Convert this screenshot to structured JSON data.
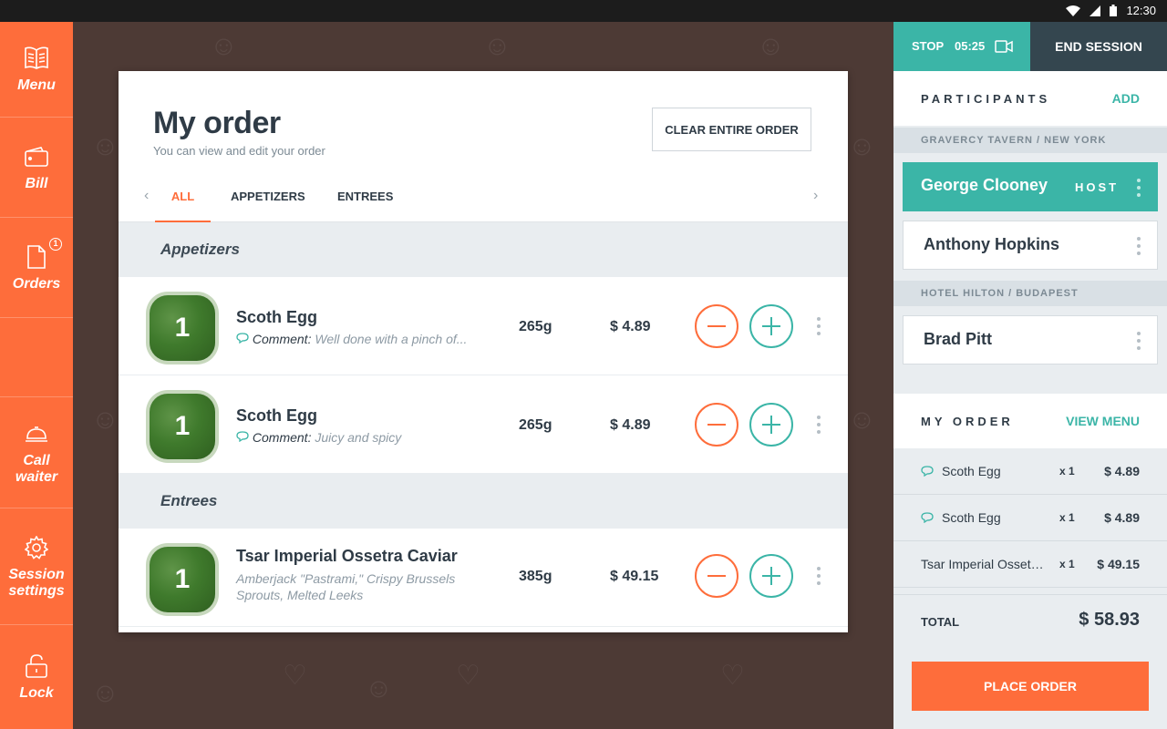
{
  "status_bar": {
    "time": "12:30"
  },
  "sidebar": {
    "items": [
      {
        "label": "Menu",
        "icon": "book-icon"
      },
      {
        "label": "Bill",
        "icon": "wallet-icon"
      },
      {
        "label": "Orders",
        "icon": "document-icon",
        "badge": "1"
      },
      {
        "label": "Call waiter",
        "icon": "service-bell-icon"
      },
      {
        "label": "Session settings",
        "icon": "gear-icon"
      },
      {
        "label": "Lock",
        "icon": "padlock-icon"
      }
    ]
  },
  "order_card": {
    "title": "My order",
    "subtitle": "You can view and edit your order",
    "clear_button": "CLEAR ENTIRE ORDER",
    "tabs": [
      {
        "label": "ALL",
        "active": true
      },
      {
        "label": "APPETIZERS",
        "active": false
      },
      {
        "label": "ENTREES",
        "active": false
      }
    ],
    "sections": [
      {
        "title": "Appetizers",
        "items": [
          {
            "qty": "1",
            "name": "Scoth Egg",
            "comment_label": "Comment:",
            "comment": "Well done with a pinch of...",
            "weight": "265g",
            "price": "$ 4.89"
          },
          {
            "qty": "1",
            "name": "Scoth Egg",
            "comment_label": "Comment:",
            "comment": "Juicy and spicy",
            "weight": "265g",
            "price": "$ 4.89"
          }
        ]
      },
      {
        "title": "Entrees",
        "items": [
          {
            "qty": "1",
            "name": "Tsar Imperial Ossetra Caviar",
            "description": "Amberjack \"Pastrami,\" Crispy Brussels Sprouts, Melted Leeks",
            "weight": "385g",
            "price": "$ 49.15"
          }
        ]
      }
    ]
  },
  "session": {
    "stop_label": "STOP",
    "timer": "05:25",
    "end_label": "END SESSION"
  },
  "participants": {
    "title": "PARTICIPANTS",
    "add_label": "ADD",
    "venues": [
      {
        "name": "GRAVERCY TAVERN / NEW YORK",
        "people": [
          {
            "name": "George Clooney",
            "role": "HOST"
          },
          {
            "name": "Anthony Hopkins"
          }
        ]
      },
      {
        "name": "HOTEL HILTON / BUDAPEST",
        "people": [
          {
            "name": "Brad Pitt"
          }
        ]
      }
    ]
  },
  "my_order": {
    "title": "MY ORDER",
    "view_menu": "VIEW MENU",
    "lines": [
      {
        "name": "Scoth Egg",
        "qty": "x 1",
        "price": "$ 4.89",
        "has_comment": true
      },
      {
        "name": "Scoth Egg",
        "qty": "x 1",
        "price": "$ 4.89",
        "has_comment": true
      },
      {
        "name": "Tsar Imperial Ossetra Caviar",
        "qty": "x 1",
        "price": "$ 49.15",
        "has_comment": false
      }
    ],
    "total_label": "TOTAL",
    "total_value": "$ 58.93",
    "place_order": "PLACE ORDER"
  },
  "colors": {
    "accent_orange": "#fe6d3b",
    "accent_teal": "#3bb5a7",
    "dark": "#34464f",
    "background": "#4d3a35"
  }
}
